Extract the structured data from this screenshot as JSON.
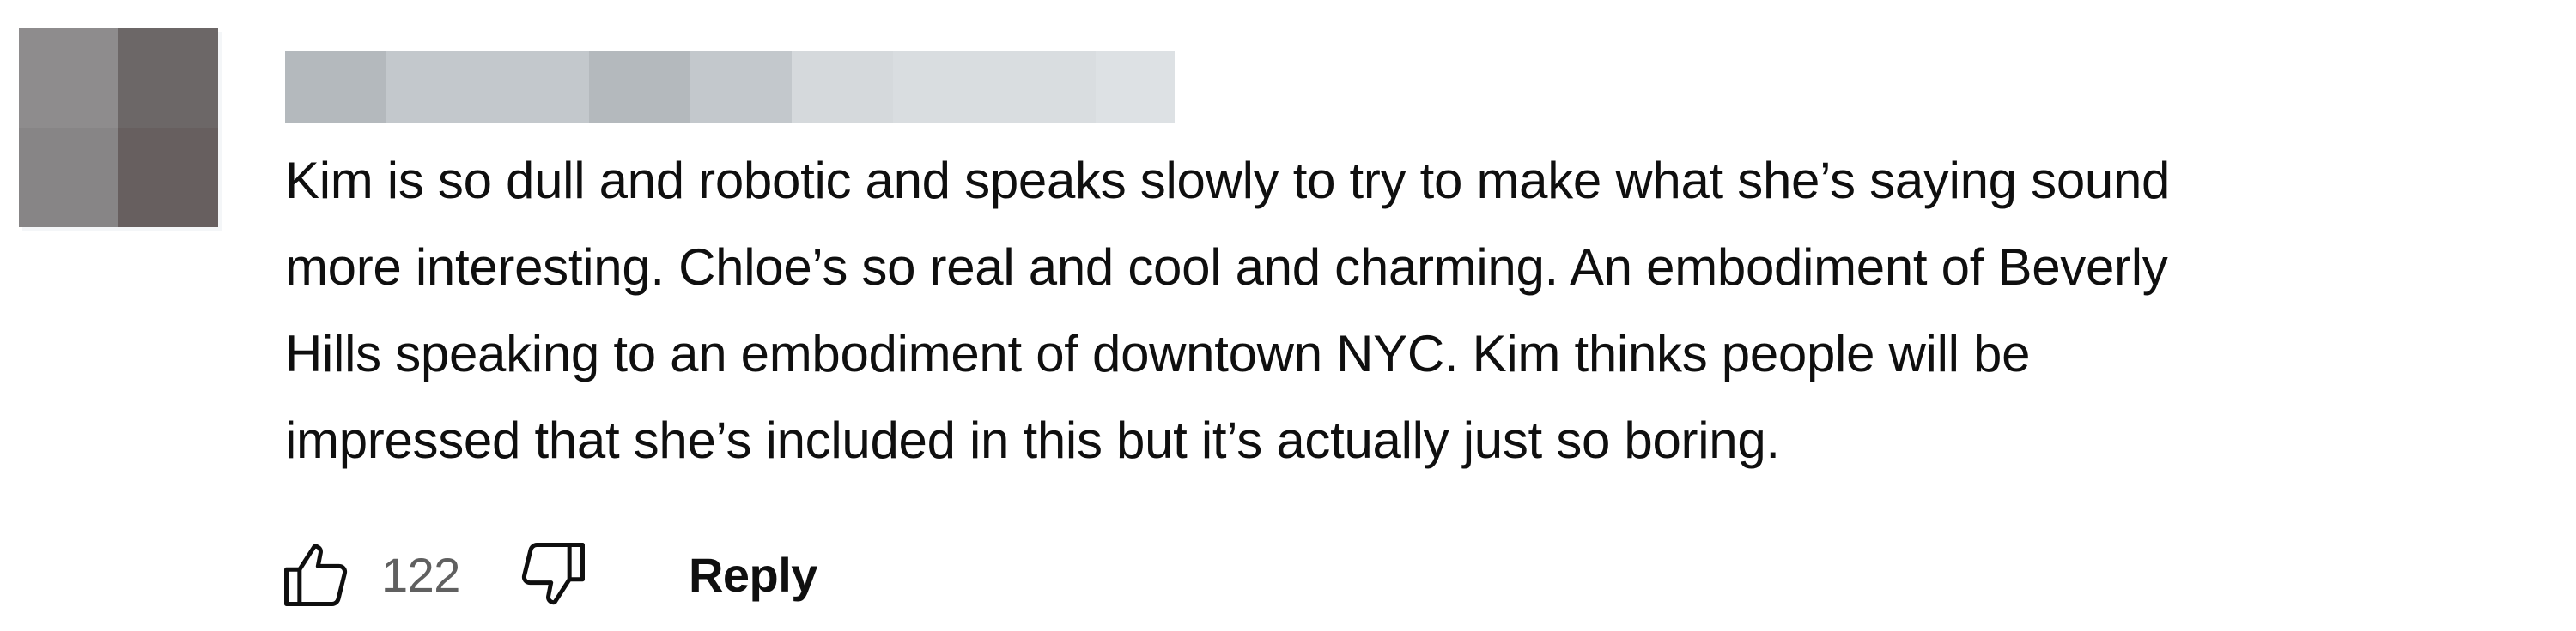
{
  "colors": {
    "text_primary": "#0f0f0f",
    "text_secondary": "#606060",
    "avatar_blocks": [
      "#8e8c8d",
      "#6c6767",
      "#878586",
      "#675f5f"
    ],
    "redacted_name_blocks": [
      "#b4b9bd",
      "#c3c8cc",
      "#c3c8cc",
      "#b4b9bd",
      "#c3c8cc",
      "#d5d9dc",
      "#d9dde0",
      "#d9dde0",
      "#dde1e4"
    ]
  },
  "comment": {
    "author_avatar_icon": "avatar-icon",
    "author_name_redacted": true,
    "text_lines": [
      "Kim is so dull and robotic and speaks slowly to try to make what she’s saying sound",
      "more interesting. Chloe’s so real and cool and charming. An embodiment of Beverly",
      "Hills speaking to an embodiment of downtown NYC. Kim thinks people will be",
      "impressed that she’s included in this but it’s actually just so boring."
    ],
    "actions": {
      "like_icon": "thumbs-up-icon",
      "like_count": "122",
      "dislike_icon": "thumbs-down-icon",
      "reply_label": "Reply"
    }
  }
}
